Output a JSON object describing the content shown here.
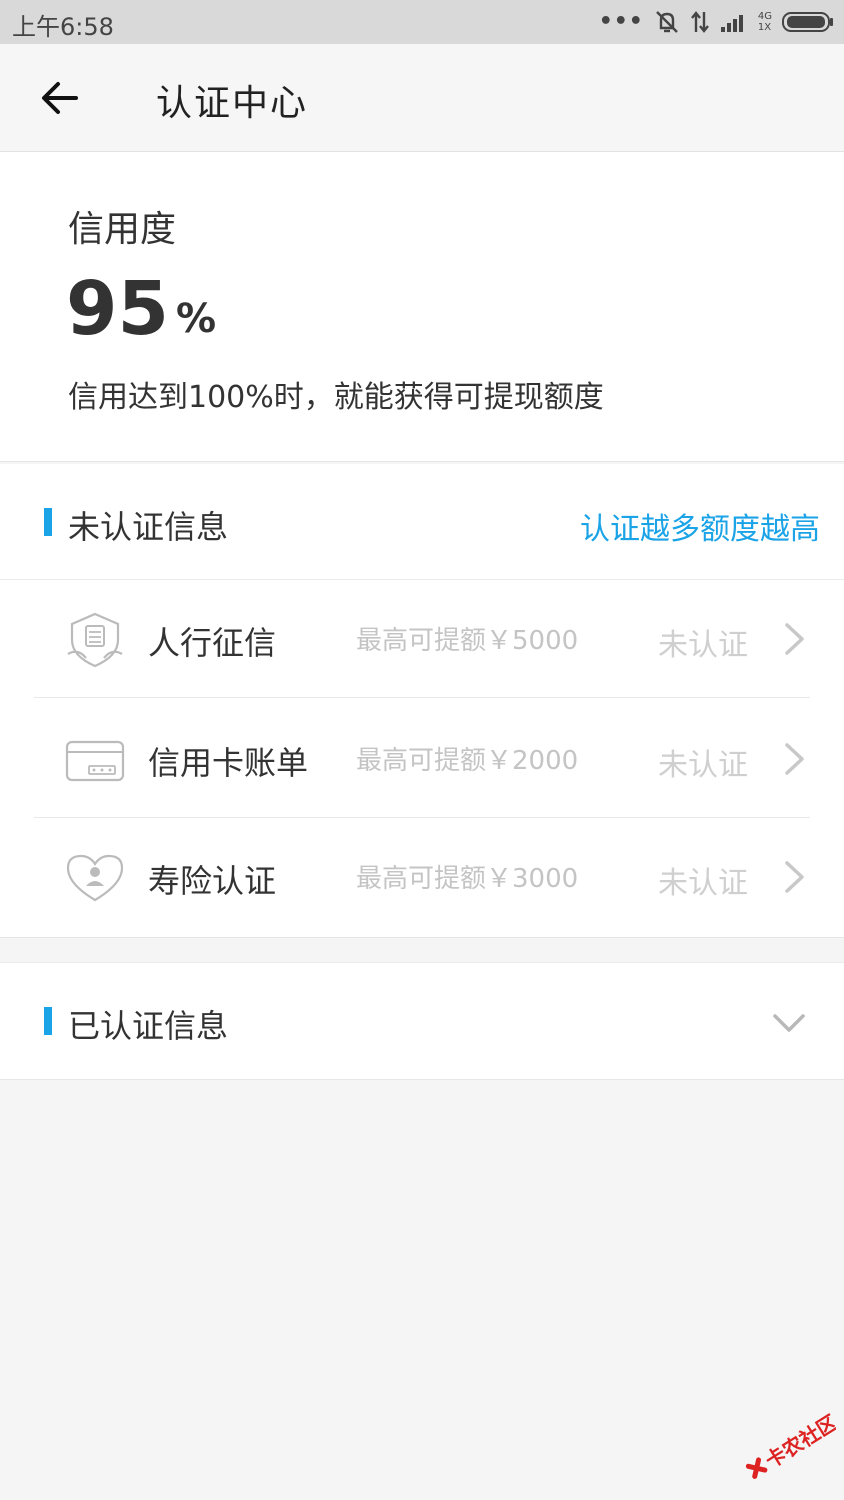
{
  "status_bar": {
    "time": "上午6:58",
    "network_top": "4G",
    "network_bottom": "1X"
  },
  "header": {
    "title": "认证中心"
  },
  "credit": {
    "label": "信用度",
    "value": "95",
    "unit": "%",
    "hint": "信用达到100%时，就能获得可提现额度"
  },
  "unverified": {
    "title": "未认证信息",
    "link": "认证越多额度越高",
    "items": [
      {
        "name": "人行征信",
        "limit": "最高可提额￥5000",
        "status": "未认证",
        "icon": "shield-credit-icon"
      },
      {
        "name": "信用卡账单",
        "limit": "最高可提额￥2000",
        "status": "未认证",
        "icon": "credit-card-icon"
      },
      {
        "name": "寿险认证",
        "limit": "最高可提额￥3000",
        "status": "未认证",
        "icon": "heart-person-icon"
      }
    ]
  },
  "verified": {
    "title": "已认证信息"
  },
  "watermark": {
    "text": "卡农社区"
  },
  "colors": {
    "accent": "#1aa3e6",
    "muted": "#c4c4c4",
    "watermark": "#d22"
  }
}
